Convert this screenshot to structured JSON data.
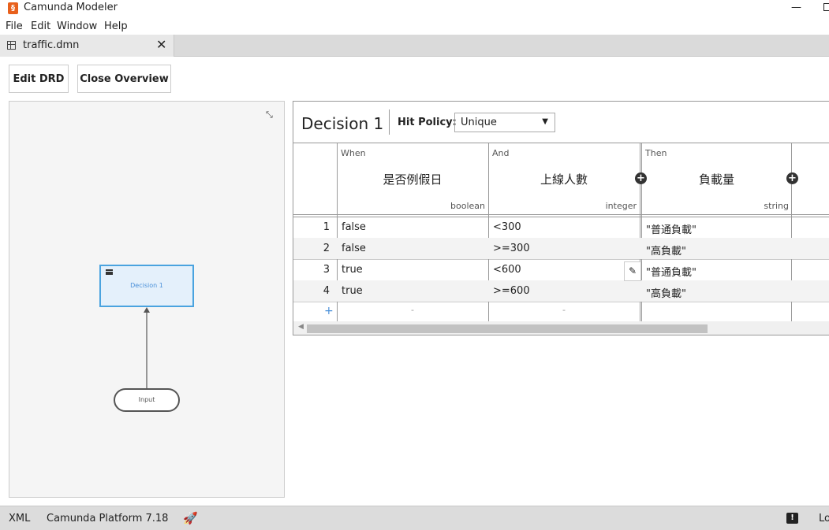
{
  "app": {
    "title": "Camunda Modeler",
    "icon_glyph": "§"
  },
  "window_controls": {
    "minimize": "—"
  },
  "menu": [
    "File",
    "Edit",
    "Window",
    "Help"
  ],
  "tab": {
    "label": "traffic.dmn",
    "close": "✕"
  },
  "toolbar": {
    "edit_drd": "Edit DRD",
    "close_overview": "Close Overview"
  },
  "drd": {
    "decision_label": "Decision 1",
    "input_label": "Input",
    "collapse_icon": "⤡"
  },
  "decision_table": {
    "name": "Decision 1",
    "hit_policy_label": "Hit Policy:",
    "hit_policy_value": "Unique",
    "columns": [
      {
        "clause": "When",
        "label": "是否例假日",
        "type": "boolean"
      },
      {
        "clause": "And",
        "label": "上線人數",
        "type": "integer"
      },
      {
        "clause": "Then",
        "label": "負載量",
        "type": "string"
      }
    ],
    "rows": [
      {
        "num": "1",
        "c1": "false",
        "c2": "<300",
        "c3": "\"普通負載\""
      },
      {
        "num": "2",
        "c1": "false",
        "c2": ">=300",
        "c3": "\"高負載\""
      },
      {
        "num": "3",
        "c1": "true",
        "c2": "<600",
        "c3": "\"普通負載\""
      },
      {
        "num": "4",
        "c1": "true",
        "c2": ">=600",
        "c3": "\"高負載\""
      }
    ],
    "add_row": "+",
    "empty_cell": "-"
  },
  "statusbar": {
    "xml": "XML",
    "platform": "Camunda Platform 7.18",
    "log": "Lo"
  },
  "colors": {
    "accent": "#4a90d9",
    "app_icon": "#e8601c",
    "decision_fill": "#e4f0fb"
  }
}
